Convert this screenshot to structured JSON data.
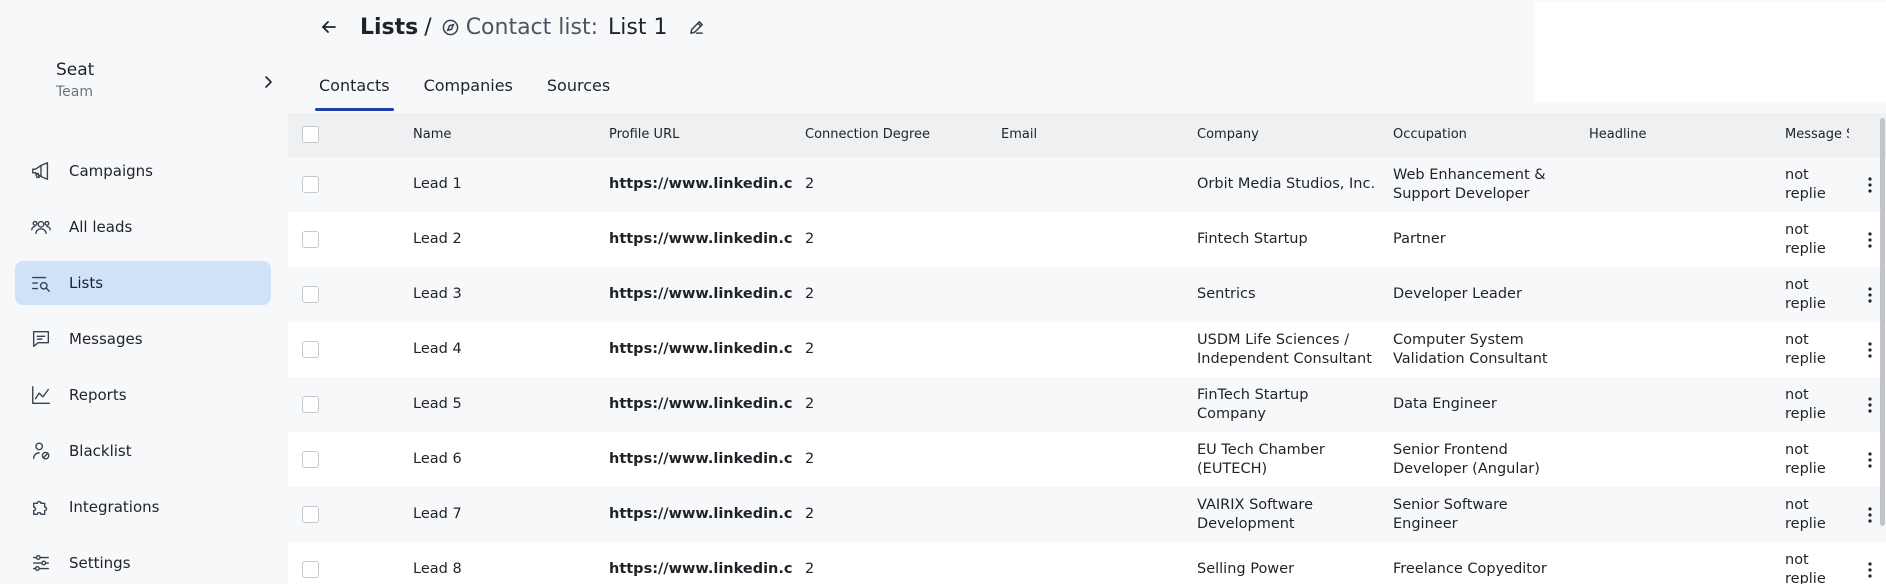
{
  "sidebar": {
    "team": {
      "name": "Seat",
      "role": "Team"
    },
    "items": [
      {
        "label": "Campaigns",
        "icon": "megaphone-icon"
      },
      {
        "label": "All leads",
        "icon": "users-icon"
      },
      {
        "label": "Lists",
        "icon": "list-search-icon",
        "active": true
      },
      {
        "label": "Messages",
        "icon": "message-icon"
      },
      {
        "label": "Reports",
        "icon": "chart-icon"
      },
      {
        "label": "Blacklist",
        "icon": "user-block-icon"
      },
      {
        "label": "Integrations",
        "icon": "puzzle-icon"
      },
      {
        "label": "Settings",
        "icon": "sliders-icon"
      }
    ]
  },
  "header": {
    "breadcrumb_root": "Lists",
    "breadcrumb_sep": "/",
    "list_kind": "Contact list:",
    "list_name": "List 1"
  },
  "tabs": [
    {
      "label": "Contacts",
      "active": true
    },
    {
      "label": "Companies"
    },
    {
      "label": "Sources"
    }
  ],
  "table": {
    "columns": [
      "Name",
      "Profile URL",
      "Connection Degree",
      "Email",
      "Company",
      "Occupation",
      "Headline",
      "Message S"
    ],
    "rows": [
      {
        "name": "Lead 1",
        "url": "https://www.linkedin.com/in",
        "degree": "2",
        "email": "",
        "company": "Orbit Media Studios, Inc.",
        "occupation": "Web Enhancement & Support Developer",
        "headline": "",
        "message_status": "not replie"
      },
      {
        "name": "Lead 2",
        "url": "https://www.linkedin.com/in",
        "degree": "2",
        "email": "",
        "company": "Fintech Startup",
        "occupation": "Partner",
        "headline": "",
        "message_status": "not replie"
      },
      {
        "name": "Lead 3",
        "url": "https://www.linkedin.com/in",
        "degree": "2",
        "email": "",
        "company": "Sentrics",
        "occupation": "Developer Leader",
        "headline": "",
        "message_status": "not replie"
      },
      {
        "name": "Lead 4",
        "url": "https://www.linkedin.com/in",
        "degree": "2",
        "email": "",
        "company": "USDM Life Sciences / Independent Consultant",
        "occupation": "Computer System Validation Consultant",
        "headline": "",
        "message_status": "not replie"
      },
      {
        "name": "Lead 5",
        "url": "https://www.linkedin.com/in",
        "degree": "2",
        "email": "",
        "company": "FinTech Startup Company",
        "occupation": "Data Engineer",
        "headline": "",
        "message_status": "not replie"
      },
      {
        "name": "Lead 6",
        "url": "https://www.linkedin.com/in",
        "degree": "2",
        "email": "",
        "company": "EU Tech Chamber (EUTECH)",
        "occupation": "Senior Frontend Developer (Angular)",
        "headline": "",
        "message_status": "not replie"
      },
      {
        "name": "Lead 7",
        "url": "https://www.linkedin.com/in",
        "degree": "2",
        "email": "",
        "company": "VAIRIX Software Development",
        "occupation": "Senior Software Engineer",
        "headline": "",
        "message_status": "not replie"
      },
      {
        "name": "Lead 8",
        "url": "https://www.linkedin.com/in",
        "degree": "2",
        "email": "",
        "company": "Selling Power",
        "occupation": "Freelance Copyeditor",
        "headline": "",
        "message_status": "not replie"
      }
    ]
  },
  "colors": {
    "active_nav": "#cfe2f7",
    "tab_underline": "#1e40af",
    "header_bg": "#eef0f2"
  }
}
